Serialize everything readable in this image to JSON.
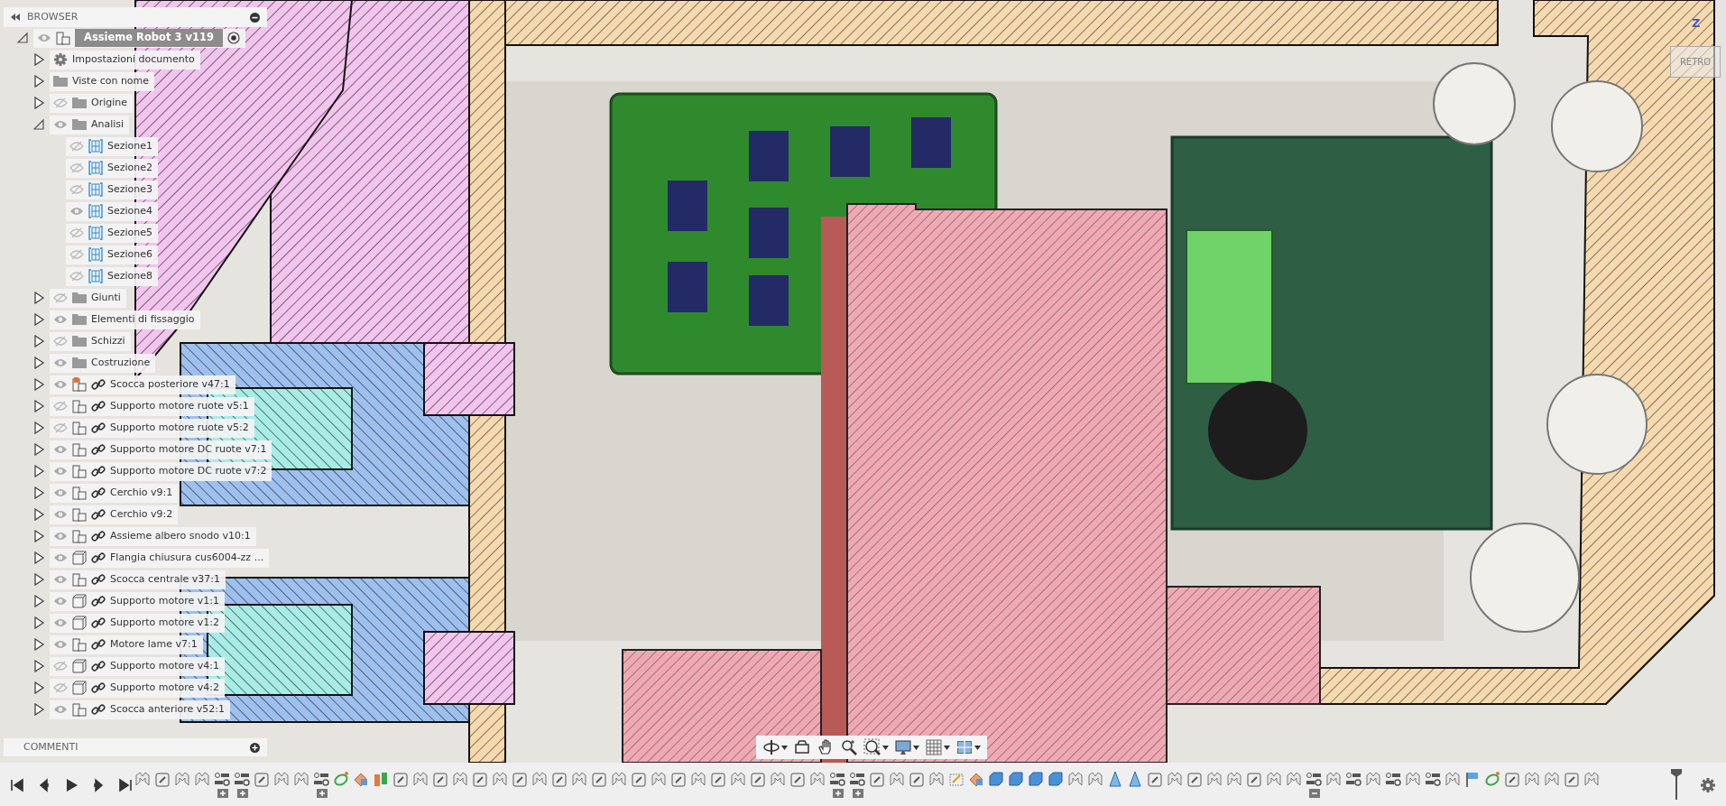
{
  "browser": {
    "title": "BROWSER",
    "root": {
      "label": "Assieme Robot 3 v119",
      "visible": true,
      "expanded": true,
      "active": true,
      "children": [
        {
          "label": "Impostazioni documento",
          "kind": "gear",
          "expanded": false
        },
        {
          "label": "Viste con nome",
          "kind": "folder",
          "expanded": false
        },
        {
          "label": "Origine",
          "kind": "folder",
          "visible": false,
          "expanded": false
        },
        {
          "label": "Analisi",
          "kind": "folder",
          "visible": true,
          "expanded": true,
          "children": [
            {
              "label": "Sezione1",
              "kind": "section",
              "visible": false
            },
            {
              "label": "Sezione2",
              "kind": "section",
              "visible": false
            },
            {
              "label": "Sezione3",
              "kind": "section",
              "visible": false
            },
            {
              "label": "Sezione4",
              "kind": "section",
              "visible": true
            },
            {
              "label": "Sezione5",
              "kind": "section",
              "visible": false
            },
            {
              "label": "Sezione6",
              "kind": "section",
              "visible": false
            },
            {
              "label": "Sezione8",
              "kind": "section",
              "visible": false
            }
          ]
        },
        {
          "label": "Giunti",
          "kind": "folder",
          "visible": false,
          "expanded": false
        },
        {
          "label": "Elementi di fissaggio",
          "kind": "folder",
          "visible": true,
          "expanded": false
        },
        {
          "label": "Schizzi",
          "kind": "folder",
          "visible": false,
          "expanded": false
        },
        {
          "label": "Costruzione",
          "kind": "folder",
          "visible": true,
          "expanded": false
        },
        {
          "label": "Scocca posteriore v47:1",
          "kind": "assembly-pinned",
          "link": true,
          "visible": true,
          "expanded": false
        },
        {
          "label": "Supporto motore ruote v5:1",
          "kind": "assembly",
          "link": true,
          "visible": false,
          "expanded": false
        },
        {
          "label": "Supporto motore ruote v5:2",
          "kind": "assembly",
          "link": true,
          "visible": false,
          "expanded": false
        },
        {
          "label": "Supporto motore DC ruote v7:1",
          "kind": "assembly",
          "link": true,
          "visible": true,
          "expanded": false
        },
        {
          "label": "Supporto motore DC ruote v7:2",
          "kind": "assembly",
          "link": true,
          "visible": true,
          "expanded": false
        },
        {
          "label": "Cerchio v9:1",
          "kind": "assembly",
          "link": true,
          "visible": true,
          "expanded": false
        },
        {
          "label": "Cerchio v9:2",
          "kind": "assembly",
          "link": true,
          "visible": true,
          "expanded": false
        },
        {
          "label": "Assieme albero snodo v10:1",
          "kind": "assembly",
          "link": true,
          "visible": true,
          "expanded": false
        },
        {
          "label": "Flangia chiusura cus6004-zz ...",
          "kind": "body",
          "link": true,
          "visible": true,
          "expanded": false
        },
        {
          "label": "Scocca centrale v37:1",
          "kind": "assembly",
          "link": true,
          "visible": true,
          "expanded": false
        },
        {
          "label": "Supporto motore v1:1",
          "kind": "body",
          "link": true,
          "visible": true,
          "expanded": false
        },
        {
          "label": "Supporto motore v1:2",
          "kind": "body",
          "link": true,
          "visible": true,
          "expanded": false
        },
        {
          "label": "Motore lame v7:1",
          "kind": "assembly",
          "link": true,
          "visible": true,
          "expanded": false
        },
        {
          "label": "Supporto motore v4:1",
          "kind": "body",
          "link": true,
          "visible": false,
          "expanded": false
        },
        {
          "label": "Supporto motore v4:2",
          "kind": "body",
          "link": true,
          "visible": false,
          "expanded": false
        },
        {
          "label": "Scocca anteriore v52:1",
          "kind": "assembly",
          "link": true,
          "visible": true,
          "expanded": false
        }
      ]
    }
  },
  "comments": {
    "title": "COMMENTI"
  },
  "viewcube": {
    "face": "RETRO",
    "axis": "Z"
  },
  "nav_toolbar": [
    {
      "kind": "orbit",
      "menu": true
    },
    {
      "kind": "look",
      "menu": false
    },
    {
      "kind": "pan",
      "menu": false
    },
    {
      "kind": "zoom",
      "menu": false
    },
    {
      "kind": "fit",
      "menu": true
    },
    {
      "kind": "display",
      "menu": true
    },
    {
      "kind": "grid",
      "menu": true
    },
    {
      "kind": "viewports",
      "menu": true
    }
  ],
  "timeline": {
    "controls": [
      {
        "kind": "first"
      },
      {
        "kind": "prev"
      },
      {
        "kind": "play"
      },
      {
        "kind": "next"
      },
      {
        "kind": "last"
      }
    ],
    "features": [
      {
        "kind": "joint"
      },
      {
        "kind": "link"
      },
      {
        "kind": "joint"
      },
      {
        "kind": "joint"
      },
      {
        "kind": "group",
        "expanded": false
      },
      {
        "kind": "group",
        "expanded": false
      },
      {
        "kind": "link"
      },
      {
        "kind": "joint"
      },
      {
        "kind": "joint"
      },
      {
        "kind": "group",
        "expanded": false
      },
      {
        "kind": "motion"
      },
      {
        "kind": "appearance"
      },
      {
        "kind": "split"
      },
      {
        "kind": "link"
      },
      {
        "kind": "joint"
      },
      {
        "kind": "link"
      },
      {
        "kind": "joint"
      },
      {
        "kind": "link"
      },
      {
        "kind": "joint"
      },
      {
        "kind": "link"
      },
      {
        "kind": "joint"
      },
      {
        "kind": "link"
      },
      {
        "kind": "joint"
      },
      {
        "kind": "link"
      },
      {
        "kind": "joint"
      },
      {
        "kind": "link"
      },
      {
        "kind": "joint"
      },
      {
        "kind": "link"
      },
      {
        "kind": "joint"
      },
      {
        "kind": "link"
      },
      {
        "kind": "joint"
      },
      {
        "kind": "link"
      },
      {
        "kind": "joint"
      },
      {
        "kind": "link"
      },
      {
        "kind": "joint"
      },
      {
        "kind": "group",
        "expanded": false
      },
      {
        "kind": "group",
        "expanded": false
      },
      {
        "kind": "link"
      },
      {
        "kind": "joint"
      },
      {
        "kind": "link"
      },
      {
        "kind": "joint"
      },
      {
        "kind": "sketch"
      },
      {
        "kind": "appearance"
      },
      {
        "kind": "box"
      },
      {
        "kind": "box"
      },
      {
        "kind": "box"
      },
      {
        "kind": "box"
      },
      {
        "kind": "joint"
      },
      {
        "kind": "joint"
      },
      {
        "kind": "plane"
      },
      {
        "kind": "plane"
      },
      {
        "kind": "link"
      },
      {
        "kind": "joint"
      },
      {
        "kind": "link"
      },
      {
        "kind": "joint"
      },
      {
        "kind": "joint"
      },
      {
        "kind": "link"
      },
      {
        "kind": "joint"
      },
      {
        "kind": "joint"
      },
      {
        "kind": "group",
        "expanded": true
      },
      {
        "kind": "joint"
      },
      {
        "kind": "group"
      },
      {
        "kind": "joint"
      },
      {
        "kind": "group"
      },
      {
        "kind": "joint"
      },
      {
        "kind": "group"
      },
      {
        "kind": "joint"
      },
      {
        "kind": "flag"
      },
      {
        "kind": "motion"
      },
      {
        "kind": "link"
      },
      {
        "kind": "joint"
      },
      {
        "kind": "joint"
      },
      {
        "kind": "link"
      },
      {
        "kind": "joint"
      }
    ]
  }
}
